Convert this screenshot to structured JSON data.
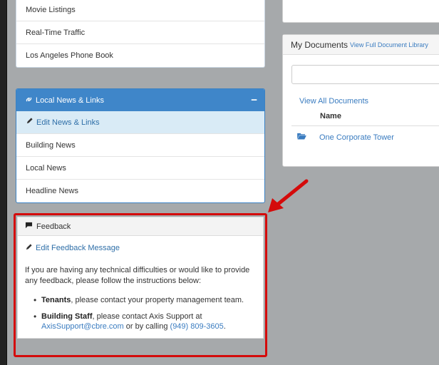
{
  "top_panel": {
    "items": [
      "Movie Listings",
      "Real-Time Traffic",
      "Los Angeles Phone Book"
    ]
  },
  "news_panel": {
    "title": "Local News & Links",
    "collapse_symbol": "−",
    "edit_label": "Edit News & Links",
    "items": [
      "Building News",
      "Local News",
      "Headline News"
    ]
  },
  "feedback_panel": {
    "title": "Feedback",
    "edit_label": "Edit Feedback Message",
    "intro": "If you are having any technical difficulties or would like to provide any feedback, please follow the instructions below:",
    "bullet1_bold": "Tenants",
    "bullet1_text": ", please contact your property management team.",
    "bullet2_bold": "Building Staff",
    "bullet2_text": ", please contact Axis Support at ",
    "bullet2_email": "AxisSupport@cbre.com",
    "bullet2_mid": " or by calling ",
    "bullet2_phone": "(949) 809-3605",
    "bullet2_end": "."
  },
  "documents": {
    "title": "My Documents",
    "library_link": "View Full Document Library",
    "view_all": "View All Documents",
    "column_name": "Name",
    "rows": [
      {
        "name": "One Corporate Tower",
        "icon": "folder-open-icon"
      }
    ]
  },
  "colors": {
    "accent": "#3f86c9",
    "highlight_border": "#d40b0b",
    "link": "#3a7cc0"
  }
}
